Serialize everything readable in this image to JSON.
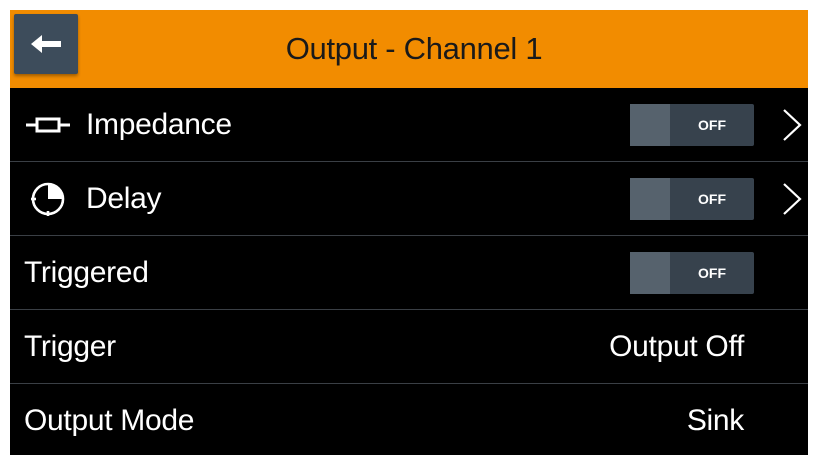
{
  "header": {
    "title": "Output - Channel 1",
    "back_icon": "arrow-left-icon",
    "background": "#f28c00"
  },
  "rows": [
    {
      "label": "Impedance",
      "icon": "impedance-resistor-icon",
      "toggle": "OFF",
      "has_chevron": true
    },
    {
      "label": "Delay",
      "icon": "clock-icon",
      "toggle": "OFF",
      "has_chevron": true
    },
    {
      "label": "Triggered",
      "toggle": "OFF",
      "has_chevron": false
    },
    {
      "label": "Trigger",
      "value": "Output Off"
    },
    {
      "label": "Output Mode",
      "value": "Sink"
    }
  ],
  "colors": {
    "background": "#000000",
    "toggle_off": "#37424d",
    "knob": "#56626d",
    "text": "#ffffff"
  }
}
